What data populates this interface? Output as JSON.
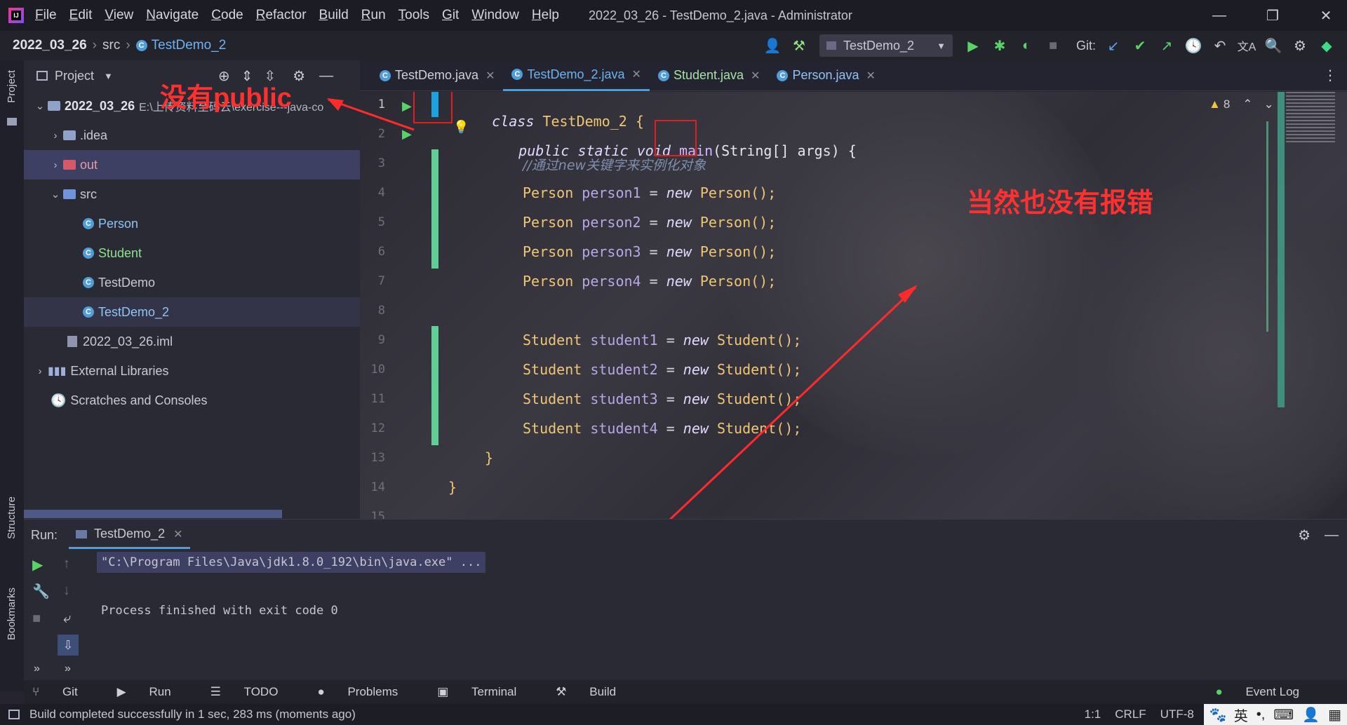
{
  "window": {
    "title": "2022_03_26 - TestDemo_2.java - Administrator",
    "menu": [
      "File",
      "Edit",
      "View",
      "Navigate",
      "Code",
      "Refactor",
      "Build",
      "Run",
      "Tools",
      "Git",
      "Window",
      "Help"
    ],
    "controls": {
      "minimize": "—",
      "restore": "❐",
      "close": "✕"
    }
  },
  "breadcrumb": {
    "project": "2022_03_26",
    "folder": "src",
    "file": "TestDemo_2"
  },
  "toolbar": {
    "run_config": "TestDemo_2",
    "git_label": "Git:"
  },
  "sidebar": {
    "project_label": "Project",
    "structure_label": "Structure",
    "bookmarks_label": "Bookmarks"
  },
  "project_panel": {
    "title": "Project",
    "root_name": "2022_03_26",
    "root_path": "E:\\上传资料至码云\\exercise---java-co",
    "items": {
      "idea": ".idea",
      "out": "out",
      "src": "src",
      "person": "Person",
      "student": "Student",
      "testdemo": "TestDemo",
      "testdemo2": "TestDemo_2",
      "iml": "2022_03_26.iml",
      "external": "External Libraries",
      "scratches": "Scratches and Consoles"
    }
  },
  "tabs": [
    {
      "label": "TestDemo.java"
    },
    {
      "label": "TestDemo_2.java"
    },
    {
      "label": "Student.java"
    },
    {
      "label": "Person.java"
    }
  ],
  "editor": {
    "warnings": "8",
    "line_numbers": [
      "1",
      "2",
      "3",
      "4",
      "5",
      "6",
      "7",
      "8",
      "9",
      "10",
      "11",
      "12",
      "13",
      "14",
      "15"
    ],
    "lines": {
      "l1_kw": "class",
      "l1_name": " TestDemo_2 {",
      "l2_kw": "public static void ",
      "l2_main": "main",
      "l2_rest": "(String[] args) {",
      "l3": "//通过new关键字来实例化对象",
      "person_type": "Person",
      "new_kw": "new",
      "person_ctor": " Person();",
      "person_vars": [
        "person1",
        "person2",
        "person3",
        "person4"
      ],
      "student_type": "Student",
      "student_ctor": " Student();",
      "student_vars": [
        "student1",
        "student2",
        "student3",
        "student4"
      ],
      "close_inner": "}",
      "close_outer": "}"
    }
  },
  "annotations": {
    "no_public": "没有public",
    "no_error": "当然也没有报错"
  },
  "run_panel": {
    "label": "Run:",
    "tab": "TestDemo_2",
    "command": "\"C:\\Program Files\\Java\\jdk1.8.0_192\\bin\\java.exe\" ...",
    "result": "Process finished with exit code 0"
  },
  "tool_windows": [
    "Git",
    "Run",
    "TODO",
    "Problems",
    "Terminal",
    "Build"
  ],
  "event_log": "Event Log",
  "status": {
    "message": "Build completed successfully in 1 sec, 283 ms (moments ago)",
    "position": "1:1",
    "line_sep": "CRLF",
    "encoding": "UTF-8",
    "ime": "英"
  },
  "colors": {
    "accent": "#4f9dd9",
    "added_lines": "#5fcf95",
    "annotation": "#ff3030"
  }
}
